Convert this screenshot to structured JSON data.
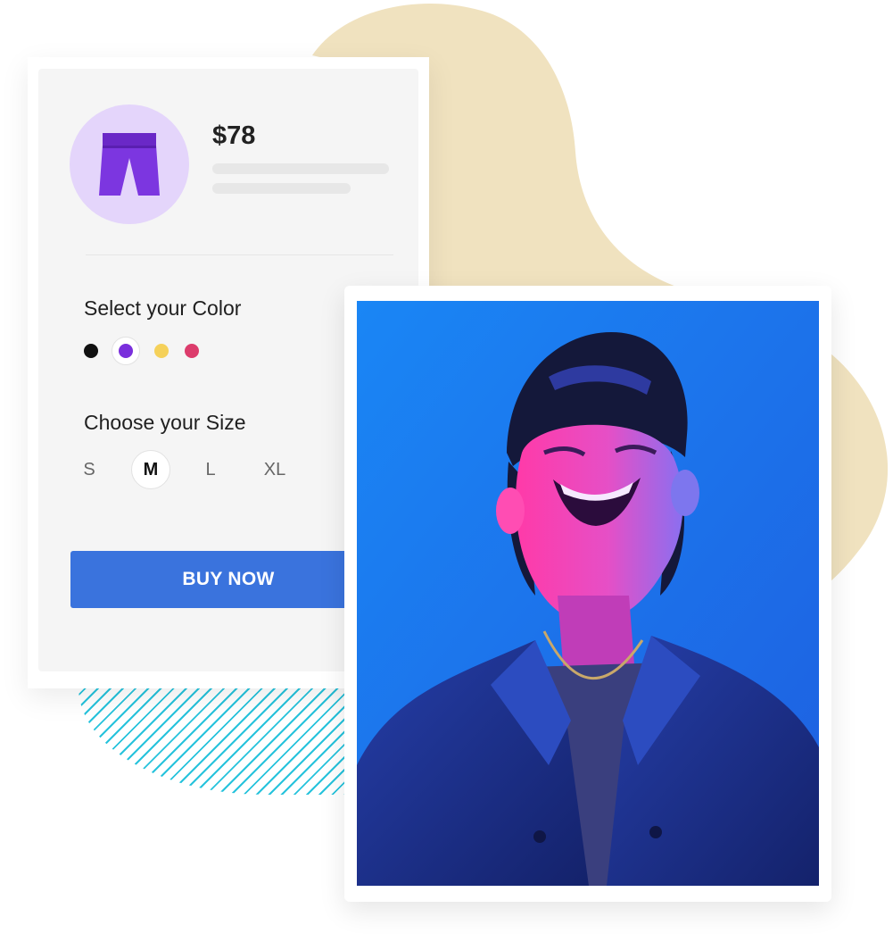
{
  "product": {
    "price": "$78",
    "icon": "pants-icon"
  },
  "color_picker": {
    "label": "Select your Color",
    "options": [
      {
        "name": "black",
        "color": "#111111"
      },
      {
        "name": "purple",
        "color": "#7a2fdc",
        "selected": true
      },
      {
        "name": "yellow",
        "color": "#f5d15a"
      },
      {
        "name": "pink",
        "color": "#dc3c6c"
      }
    ]
  },
  "size_picker": {
    "label": "Choose your Size",
    "options": [
      {
        "label": "S"
      },
      {
        "label": "M",
        "selected": true
      },
      {
        "label": "L"
      },
      {
        "label": "XL"
      }
    ]
  },
  "buy_button": {
    "label": "BUY NOW",
    "color": "#3a73dd"
  },
  "colors": {
    "blob": "#f0e2bf",
    "hatch": "#27c3dc",
    "avatar_bg": "#e4d5fb",
    "photo_bg": "#1f7cf0"
  }
}
